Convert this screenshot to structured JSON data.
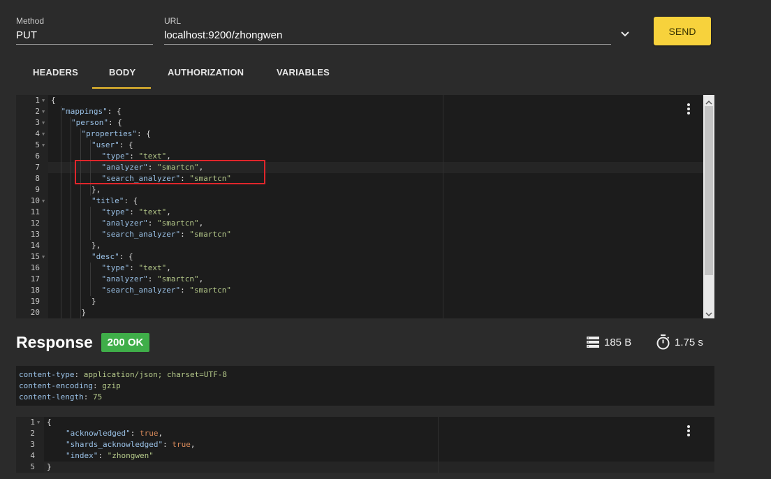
{
  "request": {
    "method_label": "Method",
    "method": "PUT",
    "url_label": "URL",
    "url": "localhost:9200/zhongwen",
    "send_label": "SEND",
    "dropdown_icon": "chevron-down-icon"
  },
  "tabs": [
    {
      "label": "HEADERS",
      "active": false
    },
    {
      "label": "BODY",
      "active": true
    },
    {
      "label": "AUTHORIZATION",
      "active": false
    },
    {
      "label": "VARIABLES",
      "active": false
    }
  ],
  "colors": {
    "accent": "#f2c12e",
    "send_button": "#f7d23c",
    "status_ok": "#3fae49",
    "highlight_box": "#e0262b",
    "json_key": "#9ac1e6",
    "json_string": "#b5c98a",
    "json_bool": "#d98a5a"
  },
  "body_editor": {
    "lines": [
      {
        "n": "1",
        "indent": 0,
        "tokens": [
          {
            "t": "p",
            "v": "{"
          }
        ]
      },
      {
        "n": "2",
        "indent": 1,
        "tokens": [
          {
            "t": "k",
            "v": "\"mappings\""
          },
          {
            "t": "p",
            "v": ": {"
          }
        ]
      },
      {
        "n": "3",
        "indent": 2,
        "tokens": [
          {
            "t": "k",
            "v": "\"person\""
          },
          {
            "t": "p",
            "v": ": {"
          }
        ]
      },
      {
        "n": "4",
        "indent": 3,
        "tokens": [
          {
            "t": "k",
            "v": "\"properties\""
          },
          {
            "t": "p",
            "v": ": {"
          }
        ]
      },
      {
        "n": "5",
        "indent": 4,
        "tokens": [
          {
            "t": "k",
            "v": "\"user\""
          },
          {
            "t": "p",
            "v": ": {"
          }
        ]
      },
      {
        "n": "6",
        "indent": 5,
        "tokens": [
          {
            "t": "k",
            "v": "\"type\""
          },
          {
            "t": "p",
            "v": ": "
          },
          {
            "t": "s",
            "v": "\"text\""
          },
          {
            "t": "p",
            "v": ","
          }
        ]
      },
      {
        "n": "7",
        "indent": 5,
        "tokens": [
          {
            "t": "k",
            "v": "\"analyzer\""
          },
          {
            "t": "p",
            "v": ": "
          },
          {
            "t": "s",
            "v": "\"smartcn\""
          },
          {
            "t": "p",
            "v": ","
          }
        ]
      },
      {
        "n": "8",
        "indent": 5,
        "tokens": [
          {
            "t": "k",
            "v": "\"search_analyzer\""
          },
          {
            "t": "p",
            "v": ": "
          },
          {
            "t": "s",
            "v": "\"smartcn\""
          }
        ]
      },
      {
        "n": "9",
        "indent": 4,
        "tokens": [
          {
            "t": "p",
            "v": "},"
          }
        ]
      },
      {
        "n": "10",
        "indent": 4,
        "tokens": [
          {
            "t": "k",
            "v": "\"title\""
          },
          {
            "t": "p",
            "v": ": {"
          }
        ]
      },
      {
        "n": "11",
        "indent": 5,
        "tokens": [
          {
            "t": "k",
            "v": "\"type\""
          },
          {
            "t": "p",
            "v": ": "
          },
          {
            "t": "s",
            "v": "\"text\""
          },
          {
            "t": "p",
            "v": ","
          }
        ]
      },
      {
        "n": "12",
        "indent": 5,
        "tokens": [
          {
            "t": "k",
            "v": "\"analyzer\""
          },
          {
            "t": "p",
            "v": ": "
          },
          {
            "t": "s",
            "v": "\"smartcn\""
          },
          {
            "t": "p",
            "v": ","
          }
        ]
      },
      {
        "n": "13",
        "indent": 5,
        "tokens": [
          {
            "t": "k",
            "v": "\"search_analyzer\""
          },
          {
            "t": "p",
            "v": ": "
          },
          {
            "t": "s",
            "v": "\"smartcn\""
          }
        ]
      },
      {
        "n": "14",
        "indent": 4,
        "tokens": [
          {
            "t": "p",
            "v": "},"
          }
        ]
      },
      {
        "n": "15",
        "indent": 4,
        "tokens": [
          {
            "t": "k",
            "v": "\"desc\""
          },
          {
            "t": "p",
            "v": ": {"
          }
        ]
      },
      {
        "n": "16",
        "indent": 5,
        "tokens": [
          {
            "t": "k",
            "v": "\"type\""
          },
          {
            "t": "p",
            "v": ": "
          },
          {
            "t": "s",
            "v": "\"text\""
          },
          {
            "t": "p",
            "v": ","
          }
        ]
      },
      {
        "n": "17",
        "indent": 5,
        "tokens": [
          {
            "t": "k",
            "v": "\"analyzer\""
          },
          {
            "t": "p",
            "v": ": "
          },
          {
            "t": "s",
            "v": "\"smartcn\""
          },
          {
            "t": "p",
            "v": ","
          }
        ]
      },
      {
        "n": "18",
        "indent": 5,
        "tokens": [
          {
            "t": "k",
            "v": "\"search_analyzer\""
          },
          {
            "t": "p",
            "v": ": "
          },
          {
            "t": "s",
            "v": "\"smartcn\""
          }
        ]
      },
      {
        "n": "19",
        "indent": 4,
        "tokens": [
          {
            "t": "p",
            "v": "}"
          }
        ]
      },
      {
        "n": "20",
        "indent": 3,
        "tokens": [
          {
            "t": "p",
            "v": "}"
          }
        ]
      }
    ],
    "foldable_lines": [
      "1",
      "2",
      "3",
      "4",
      "5",
      "10",
      "15"
    ],
    "highlighted_lines": [
      "7",
      "8"
    ]
  },
  "response": {
    "title": "Response",
    "status": "200 OK",
    "size": "185 B",
    "time": "1.75 s",
    "size_icon": "database-icon",
    "time_icon": "stopwatch-icon",
    "headers": [
      {
        "key": "content-type",
        "value": "application/json; charset=UTF-8"
      },
      {
        "key": "content-encoding",
        "value": "gzip"
      },
      {
        "key": "content-length",
        "value": "75"
      }
    ],
    "body_lines": [
      {
        "n": "1",
        "indent": 0,
        "tokens": [
          {
            "t": "p",
            "v": "{"
          }
        ]
      },
      {
        "n": "2",
        "indent": 1,
        "tokens": [
          {
            "t": "k",
            "v": "\"acknowledged\""
          },
          {
            "t": "p",
            "v": ": "
          },
          {
            "t": "b",
            "v": "true"
          },
          {
            "t": "p",
            "v": ","
          }
        ]
      },
      {
        "n": "3",
        "indent": 1,
        "tokens": [
          {
            "t": "k",
            "v": "\"shards_acknowledged\""
          },
          {
            "t": "p",
            "v": ": "
          },
          {
            "t": "b",
            "v": "true"
          },
          {
            "t": "p",
            "v": ","
          }
        ]
      },
      {
        "n": "4",
        "indent": 1,
        "tokens": [
          {
            "t": "k",
            "v": "\"index\""
          },
          {
            "t": "p",
            "v": ": "
          },
          {
            "t": "s",
            "v": "\"zhongwen\""
          }
        ]
      },
      {
        "n": "5",
        "indent": 0,
        "tokens": [
          {
            "t": "p",
            "v": "}"
          }
        ]
      }
    ],
    "foldable_lines": [
      "1"
    ]
  }
}
